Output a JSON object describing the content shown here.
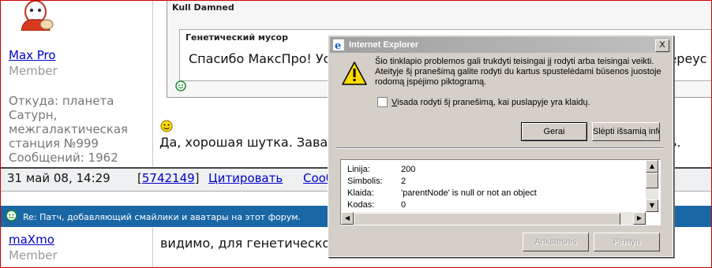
{
  "forum": {
    "post1": {
      "username": "Max Pro",
      "role": "Member",
      "info": "Откуда: планета Сатурн, межгалактическая станция №999\nСообщений: 1962",
      "quote_author": "Kull Damned",
      "inner_quote_title": "Генетический мусор",
      "inner_quote_text": "Спасибо МаксПро! Ус",
      "inner_quote_tail": "переус",
      "post_text": "Да, хорошая шутка. Завали",
      "post_tail": "ь.",
      "date": "31 май 08, 14:29",
      "post_id_open": "[",
      "post_id": "5742149",
      "post_id_close": "]",
      "quote_action": "Цитировать",
      "more_action": "Сооб"
    },
    "topic_title": "Re: Патч, добавляющий смайлики и аватары на этот форум.",
    "post2": {
      "username": "maXmo",
      "role": "Member",
      "text": "видимо, для генетического"
    }
  },
  "dialog": {
    "title": "Internet Explorer",
    "close_glyph": "X",
    "message": "Šio tinklapio problemos gali trukdyti teisingai jį rodyti arba teisingai veikti. Ateityje šį pranešimą galite rodyti du kartus spustelėdami būsenos juostoje rodomą įspėjimo piktogramą.",
    "checkbox_label_underlined": "V",
    "checkbox_label": "isada rodyti šį pranešimą, kai puslapyje yra klaidų.",
    "ok_button": "Gerai",
    "details_button": "Slėpti išsamią info",
    "details": [
      {
        "label": "Linija:",
        "value": "200"
      },
      {
        "label": "Simbolis:",
        "value": "2"
      },
      {
        "label": "Klaida:",
        "value": "'parentNode' is null or not an object"
      },
      {
        "label": "Kodas:",
        "value": "0"
      }
    ],
    "prev_button": "Ankstesnis",
    "next_button": "Pirmyn"
  }
}
